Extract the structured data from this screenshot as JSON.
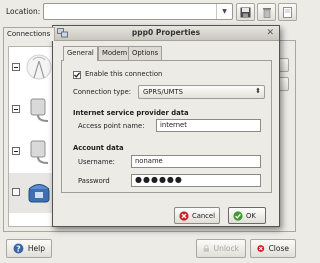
{
  "background_window": {
    "location_label": "Location:",
    "tab_connections": "Connections",
    "help_label": "Help",
    "unlock_label": "Unlock",
    "close_label": "Close"
  },
  "dialog": {
    "title": "ppp0 Properties",
    "tabs": [
      {
        "label": "General",
        "active": true
      },
      {
        "label": "Modem",
        "active": false
      },
      {
        "label": "Options",
        "active": false
      }
    ],
    "enable_connection": {
      "label": "Enable this connection",
      "checked": true
    },
    "connection_type": {
      "label": "Connection type:",
      "value": "GPRS/UMTS"
    },
    "isp_section_title": "Internet service provider data",
    "access_point": {
      "label": "Access point name:",
      "value": "internet"
    },
    "account_section_title": "Account data",
    "username": {
      "label": "Username:",
      "value": "noname"
    },
    "password": {
      "label": "Password",
      "value": "●●●●●●"
    },
    "cancel_label": "Cancel",
    "ok_label": "OK"
  },
  "colors": {
    "cancel_icon": "#cc1f1f",
    "ok_icon": "#3f9c2e",
    "help_icon": "#3566a8",
    "close_icon": "#cc1f1f"
  }
}
